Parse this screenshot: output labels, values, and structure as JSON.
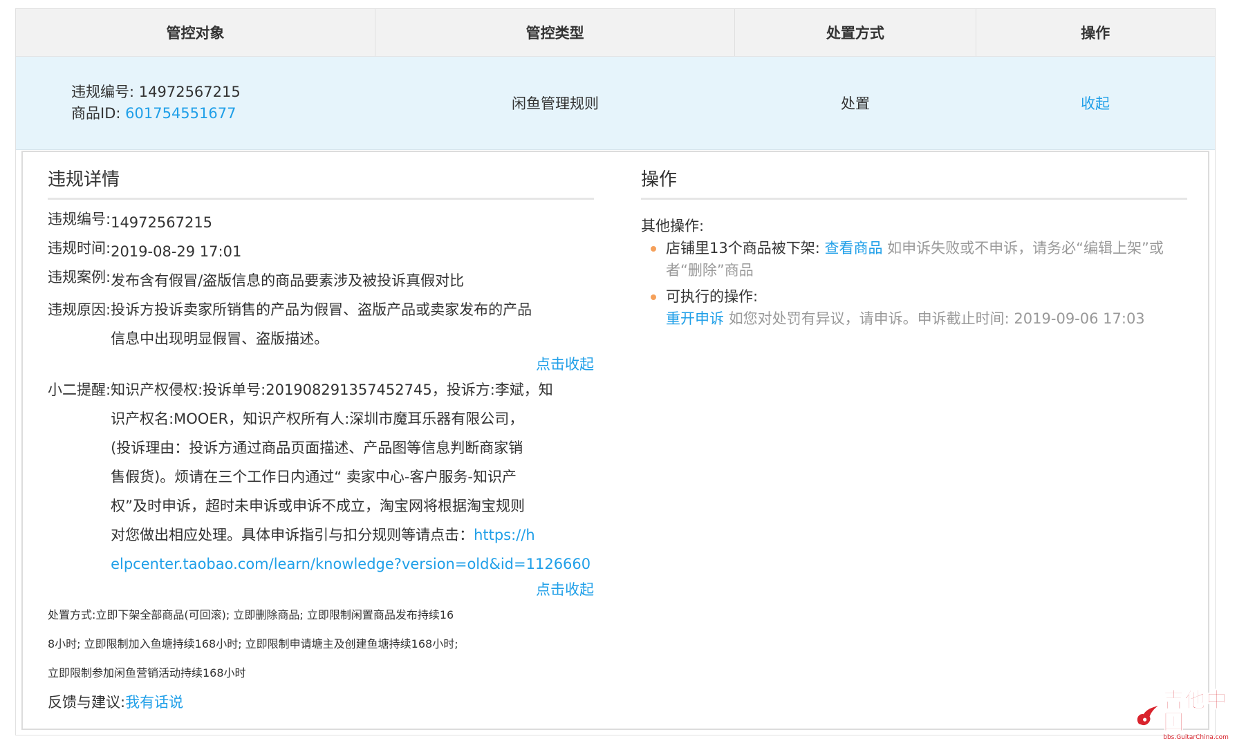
{
  "table": {
    "headers": [
      "管控对象",
      "管控类型",
      "处置方式",
      "操作"
    ],
    "row": {
      "violation_no_label": "违规编号:",
      "violation_no": "14972567215",
      "item_id_label": "商品ID:",
      "item_id": "601754551677",
      "control_type": "闲鱼管理规则",
      "disposal": "处置",
      "action": "收起"
    }
  },
  "detail": {
    "title": "违规详情",
    "no_label": "违规编号:",
    "no_value": "14972567215",
    "time_label": "违规时间:",
    "time_value": "2019-08-29 17:01",
    "case_label": "违规案例:",
    "case_value": "发布含有假冒/盗版信息的商品要素涉及被投诉真假对比",
    "reason_label": "违规原因:",
    "reason_lines": [
      "投诉方投诉卖家所销售的产品为假冒、盗版产品或卖家发布的产品",
      "信息中出现明显假冒、盗版描述。"
    ],
    "collapse_1": "点击收起",
    "tip_label": "小二提醒:",
    "tip_lines": [
      "知识产权侵权:投诉单号:201908291357452745，投诉方:李斌，知",
      "识产权名:MOOER，知识产权所有人:深圳市魔耳乐器有限公司，",
      "(投诉理由：投诉方通过商品页面描述、产品图等信息判断商家销",
      "售假货)。烦请在三个工作日内通过“ 卖家中心-客户服务-知识产",
      "权”及时申诉，超时未申诉或申诉不成立，淘宝网将根据淘宝规则"
    ],
    "tip_last_text": "对您做出相应处理。具体申诉指引与扣分规则等请点击：",
    "tip_link_1": "https://h",
    "tip_link_2": "elpcenter.taobao.com/learn/knowledge?version=old&id=1126660",
    "collapse_2": "点击收起",
    "disposal_label": "处置方式:",
    "disposal_lines": [
      "立即下架全部商品(可回滚); 立即删除商品; 立即限制闲置商品发布持续16",
      "8小时; 立即限制加入鱼塘持续168小时; 立即限制申请塘主及创建鱼塘持续168小时;",
      "立即限制参加闲鱼营销活动持续168小时"
    ],
    "feedback_label": "反馈与建议:",
    "feedback_link": "我有话说"
  },
  "operations": {
    "title": "操作",
    "other_label": "其他操作:",
    "item1_text": "店铺里13个商品被下架:",
    "item1_link": "查看商品",
    "item1_note_1": "如申诉失败或不申诉，请务必“编辑上架”或",
    "item1_note_2": "者“删除”商品",
    "item2_text": "可执行的操作:",
    "item2_link": "重开申诉",
    "item2_note": "如您对处罚有异议，请申诉。申诉截止时间: 2019-09-06 17:03"
  },
  "watermark": {
    "cn": "吉他中国",
    "en": "bbs.GuitarChina.com"
  }
}
